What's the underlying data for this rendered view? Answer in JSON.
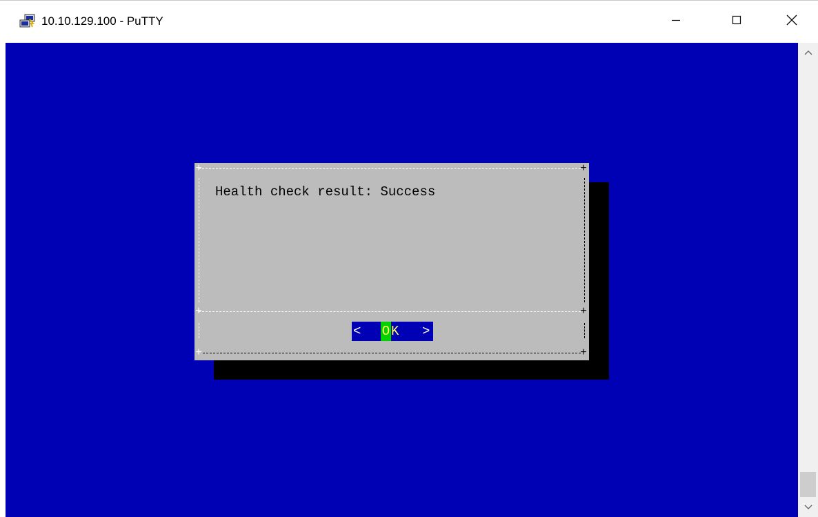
{
  "window": {
    "title": "10.10.129.100 - PuTTY",
    "icon": "putty-app-icon",
    "controls": {
      "minimize_icon": "minimize-icon",
      "maximize_icon": "maximize-icon",
      "close_icon": "close-icon"
    }
  },
  "terminal": {
    "background_color": "#0000b4",
    "dialog": {
      "message": "Health check result: Success",
      "button": {
        "left_bracket": "<",
        "label_first": "O",
        "label_rest": "K",
        "right_bracket": ">"
      },
      "background_color": "#bcbcbc",
      "shadow_color": "#000000"
    }
  },
  "scrollbar": {
    "up_icon": "chevron-up-icon",
    "down_icon": "chevron-down-icon"
  }
}
